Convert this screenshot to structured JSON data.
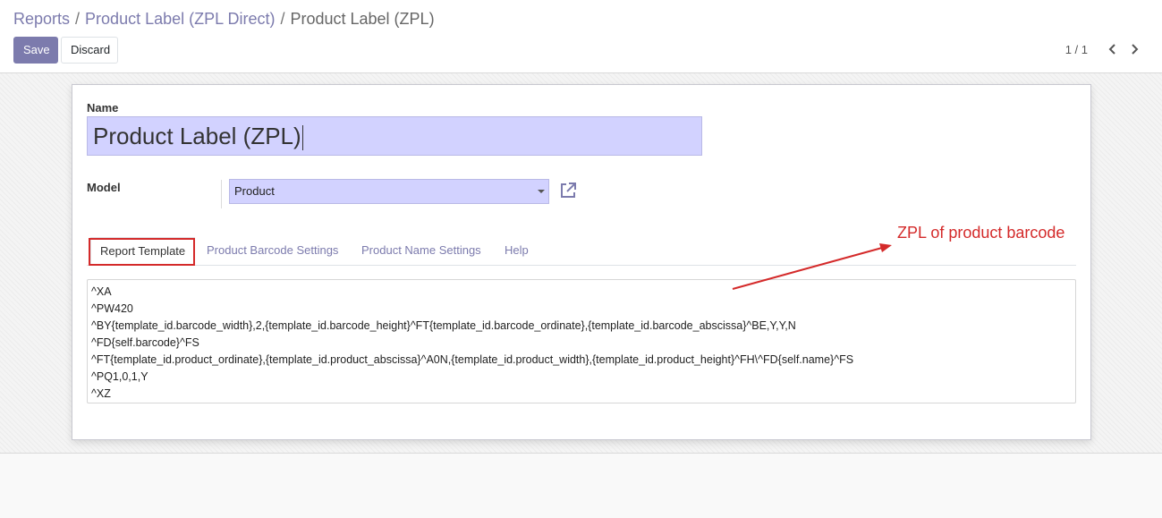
{
  "breadcrumb": {
    "items": [
      "Reports",
      "Product Label (ZPL Direct)"
    ],
    "current": "Product Label (ZPL)",
    "separator": "/"
  },
  "toolbar": {
    "save_label": "Save",
    "discard_label": "Discard"
  },
  "pager": {
    "value": "1 / 1",
    "prev_icon": "chevron-left-icon",
    "next_icon": "chevron-right-icon"
  },
  "form": {
    "name_label": "Name",
    "name_value": "Product Label (ZPL)",
    "model_label": "Model",
    "model_value": "Product",
    "external_link_icon": "external-link-icon"
  },
  "tabs": [
    {
      "label": "Report Template",
      "active": true
    },
    {
      "label": "Product Barcode Settings",
      "active": false
    },
    {
      "label": "Product Name Settings",
      "active": false
    },
    {
      "label": "Help",
      "active": false
    }
  ],
  "template_lines": [
    "^XA",
    "^PW420",
    "^BY{template_id.barcode_width},2,{template_id.barcode_height}^FT{template_id.barcode_ordinate},{template_id.barcode_abscissa}^BE,Y,Y,N",
    "^FD{self.barcode}^FS",
    "^FT{template_id.product_ordinate},{template_id.product_abscissa}^A0N,{template_id.product_width},{template_id.product_height}^FH\\^FD{self.name}^FS",
    "^PQ1,0,1,Y",
    "^XZ"
  ],
  "annotation": {
    "text": "ZPL of product barcode"
  },
  "colors": {
    "accent": "#7c7bad",
    "input_highlight": "#d2d2ff",
    "annotation_red": "#d42a2a"
  }
}
